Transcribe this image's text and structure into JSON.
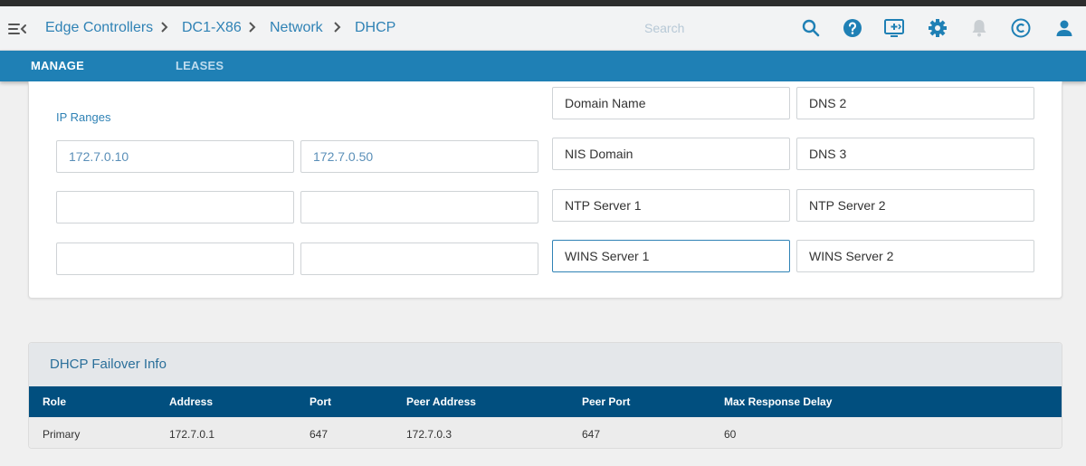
{
  "breadcrumbs": [
    "Edge Controllers",
    "DC1-X86",
    "Network",
    "DHCP"
  ],
  "search": {
    "placeholder": "Search"
  },
  "tabs": [
    {
      "label": "MANAGE",
      "active": true
    },
    {
      "label": "LEASES",
      "active": false
    }
  ],
  "dhcp_options": {
    "ip_ranges_label": "IP Ranges",
    "ip_ranges": [
      {
        "start": "172.7.0.10",
        "end": "172.7.0.50"
      },
      {
        "start": "",
        "end": ""
      },
      {
        "start": "",
        "end": ""
      }
    ],
    "fields": {
      "domain_name": "Domain Name",
      "dns2": "DNS 2",
      "nis_domain": "NIS Domain",
      "dns3": "DNS 3",
      "ntp1": "NTP Server 1",
      "ntp2": "NTP Server 2",
      "wins1": "WINS Server 1",
      "wins2": "WINS Server 2"
    }
  },
  "failover": {
    "title": "DHCP Failover Info",
    "columns": [
      "Role",
      "Address",
      "Port",
      "Peer Address",
      "Peer Port",
      "Max Response Delay"
    ],
    "rows": [
      [
        "Primary",
        "172.7.0.1",
        "647",
        "172.7.0.3",
        "647",
        "60"
      ]
    ]
  },
  "colors": {
    "accent": "#1f80b5",
    "table_header": "#014f7f",
    "link": "#2f82b5"
  },
  "icons": [
    "menu-collapse-icon",
    "chevron-right-icon",
    "search-icon",
    "help-icon",
    "console-icon",
    "gear-icon",
    "bell-icon",
    "copyright-icon",
    "user-icon"
  ]
}
